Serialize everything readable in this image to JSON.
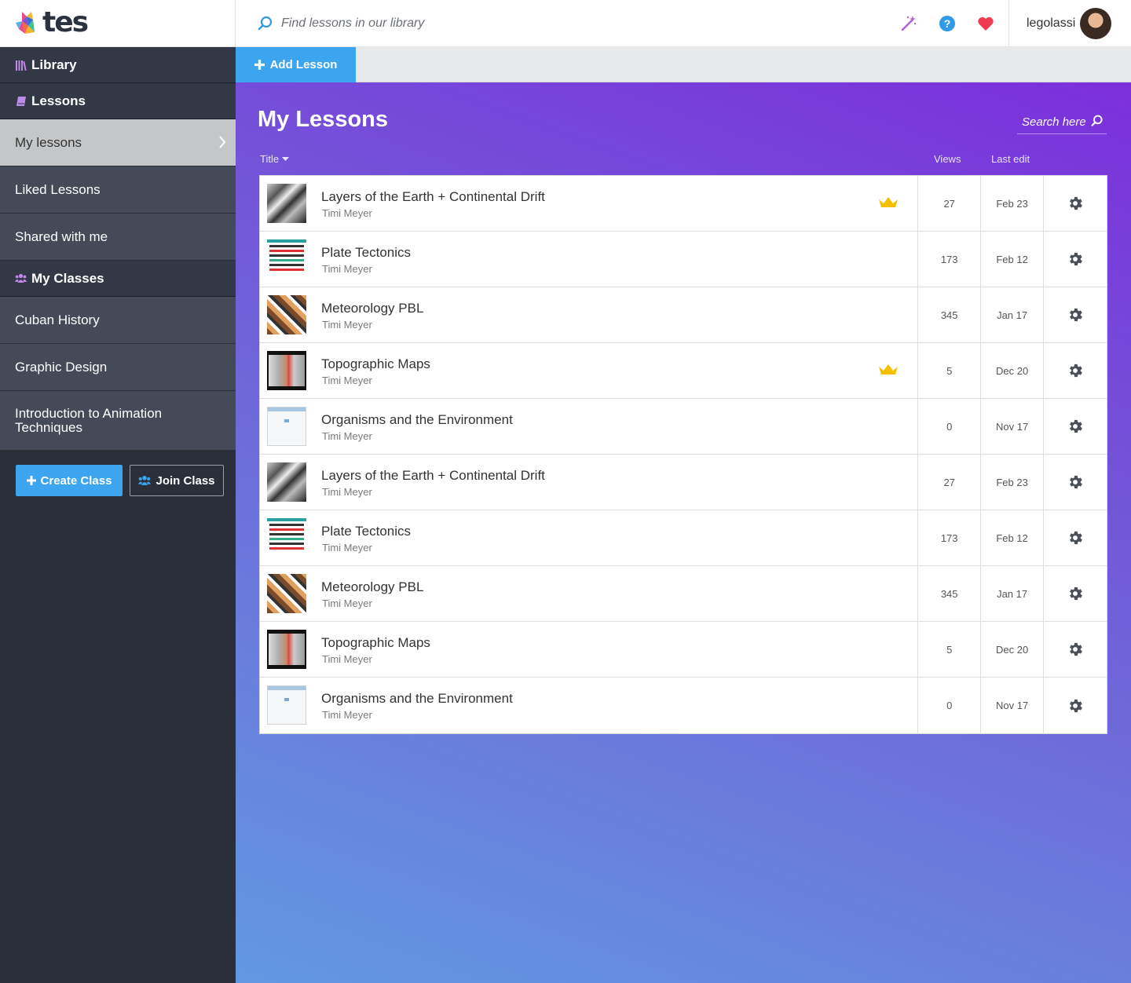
{
  "brand": {
    "name": "tes"
  },
  "header": {
    "search_placeholder": "Find lessons in our library",
    "username": "legolassi",
    "icons": [
      "magic-wand-icon",
      "help-icon",
      "heart-icon"
    ],
    "colors": {
      "wand": "#b066d8",
      "help": "#2f9ae8",
      "heart": "#f03a4f"
    }
  },
  "sidebar": {
    "library_label": "Library",
    "lessons_label": "Lessons",
    "lesson_items": [
      {
        "label": "My lessons",
        "active": true
      },
      {
        "label": "Liked Lessons"
      },
      {
        "label": "Shared with me"
      }
    ],
    "classes_label": "My Classes",
    "class_items": [
      {
        "label": "Cuban History"
      },
      {
        "label": "Graphic Design"
      },
      {
        "label": "Introduction to Animation Techniques"
      }
    ],
    "create_class_label": "Create Class",
    "join_class_label": "Join Class"
  },
  "toolbar": {
    "add_lesson_label": "Add Lesson"
  },
  "main": {
    "title": "My Lessons",
    "search_placeholder": "Search here",
    "columns": {
      "title": "Title",
      "views": "Views",
      "last_edit": "Last edit"
    },
    "lessons": [
      {
        "title": "Layers of the Earth + Continental Drift",
        "author": "Timi Meyer",
        "views": "27",
        "last_edit": "Feb 23",
        "thumb": "photo",
        "premium": true
      },
      {
        "title": "Plate Tectonics",
        "author": "Timi Meyer",
        "views": "173",
        "last_edit": "Feb 12",
        "thumb": "spell",
        "premium": false
      },
      {
        "title": "Meteorology PBL",
        "author": "Timi Meyer",
        "views": "345",
        "last_edit": "Jan 17",
        "thumb": "meteo",
        "premium": false
      },
      {
        "title": "Topographic Maps",
        "author": "Timi Meyer",
        "views": "5",
        "last_edit": "Dec 20",
        "thumb": "topo",
        "premium": true
      },
      {
        "title": "Organisms and the Environment",
        "author": "Timi Meyer",
        "views": "0",
        "last_edit": "Nov 17",
        "thumb": "org",
        "premium": false
      },
      {
        "title": "Layers of the Earth + Continental Drift",
        "author": "Timi Meyer",
        "views": "27",
        "last_edit": "Feb 23",
        "thumb": "photo",
        "premium": false
      },
      {
        "title": "Plate Tectonics",
        "author": "Timi Meyer",
        "views": "173",
        "last_edit": "Feb 12",
        "thumb": "spell",
        "premium": false
      },
      {
        "title": "Meteorology PBL",
        "author": "Timi Meyer",
        "views": "345",
        "last_edit": "Jan 17",
        "thumb": "meteo",
        "premium": false
      },
      {
        "title": "Topographic Maps",
        "author": "Timi Meyer",
        "views": "5",
        "last_edit": "Dec 20",
        "thumb": "topo",
        "premium": false
      },
      {
        "title": "Organisms and the Environment",
        "author": "Timi Meyer",
        "views": "0",
        "last_edit": "Nov 17",
        "thumb": "org",
        "premium": false
      }
    ]
  },
  "colors": {
    "accent_blue": "#3da4f0",
    "sidebar_bg": "#2a2f3a",
    "crown": "#f5c000",
    "gradient_top": "#7c2fdc",
    "gradient_bottom": "#6298e2"
  }
}
